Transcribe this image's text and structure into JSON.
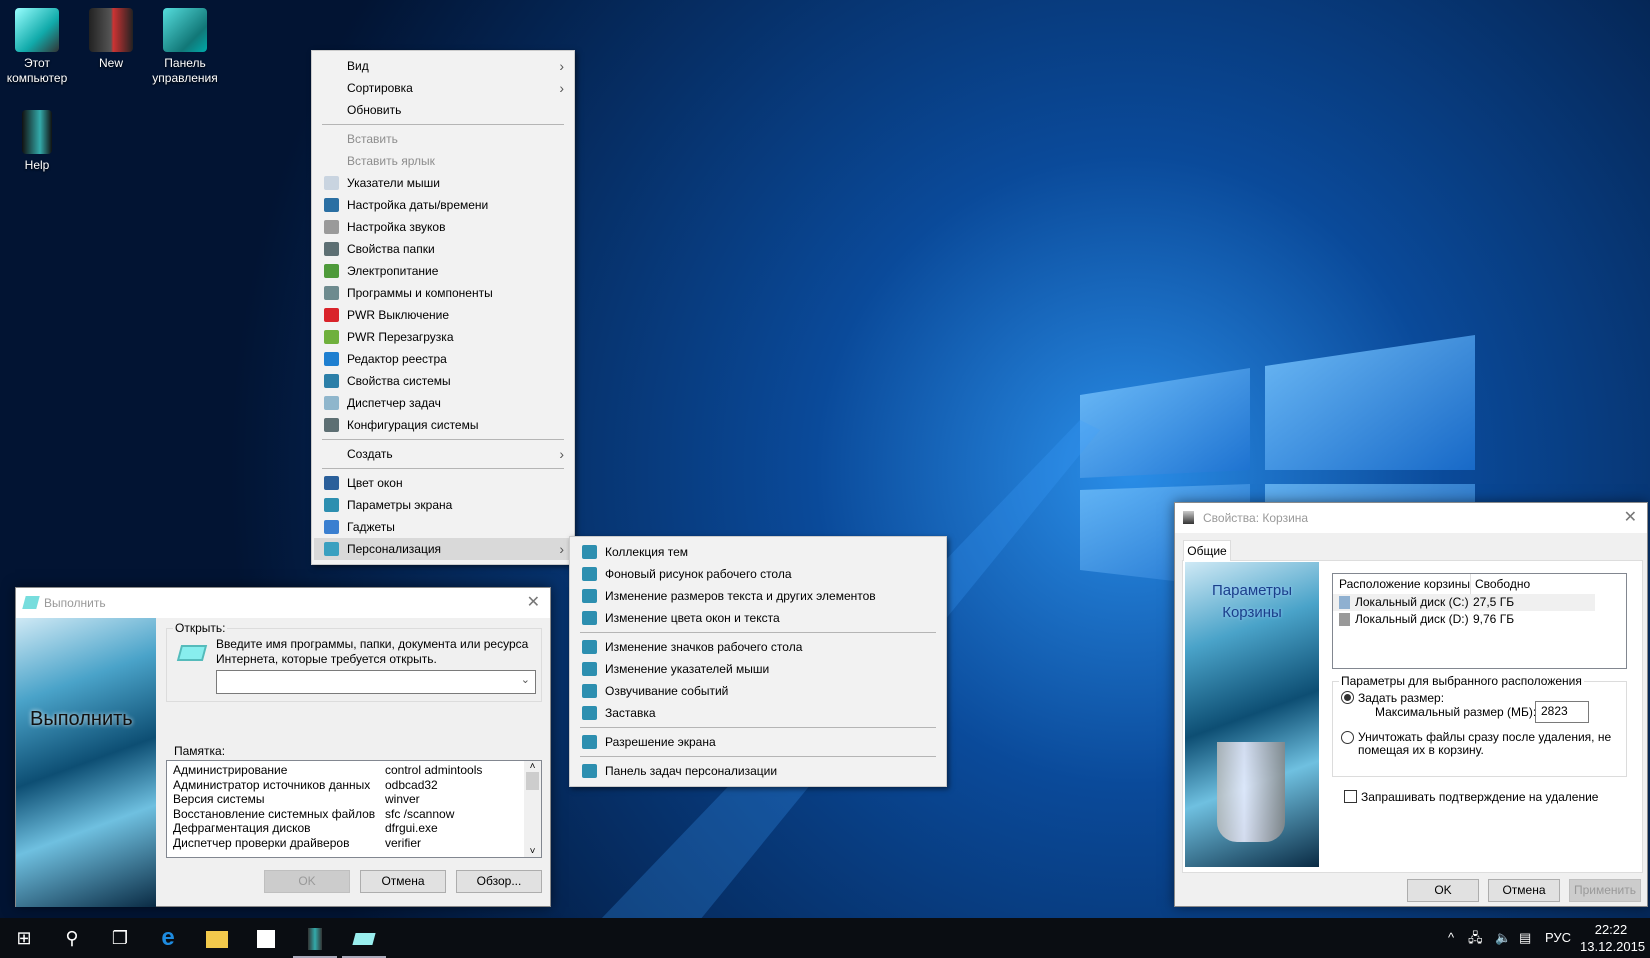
{
  "desktop": {
    "icons": [
      {
        "label": "Этот компьютер",
        "icon": "computer-icon"
      },
      {
        "label": "New",
        "icon": "user-folder-icon"
      },
      {
        "label": "Панель управления",
        "icon": "control-panel-icon"
      },
      {
        "label": "Help",
        "icon": "help-icon"
      }
    ]
  },
  "context_menu": {
    "group1": [
      {
        "label": "Вид",
        "submenu": true
      },
      {
        "label": "Сортировка",
        "submenu": true
      },
      {
        "label": "Обновить"
      }
    ],
    "group2": [
      {
        "label": "Вставить",
        "disabled": true
      },
      {
        "label": "Вставить ярлык",
        "disabled": true
      },
      {
        "label": "Указатели мыши",
        "icon": "cursor-icon",
        "color": "#c9d4e0"
      },
      {
        "label": "Настройка даты/времени",
        "icon": "datetime-icon",
        "color": "#2a6fa3"
      },
      {
        "label": "Настройка звуков",
        "icon": "speaker-icon",
        "color": "#9a9a9a"
      },
      {
        "label": "Свойства папки",
        "icon": "folder-options-icon",
        "color": "#5d6f73"
      },
      {
        "label": "Электропитание",
        "icon": "power-plug-icon",
        "color": "#4e9a3a"
      },
      {
        "label": "Программы и компоненты",
        "icon": "programs-icon",
        "color": "#6e8b8f"
      },
      {
        "label": "PWR Выключение",
        "icon": "shutdown-icon",
        "color": "#d9232a"
      },
      {
        "label": "PWR Перезагрузка",
        "icon": "restart-icon",
        "color": "#6fb03c"
      },
      {
        "label": "Редактор реестра",
        "icon": "registry-icon",
        "color": "#1e7fd0"
      },
      {
        "label": "Свойства системы",
        "icon": "system-properties-icon",
        "color": "#2c7fa8"
      },
      {
        "label": "Диспетчер задач",
        "icon": "task-manager-icon",
        "color": "#8fb6cc"
      },
      {
        "label": "Конфигурация системы",
        "icon": "msconfig-icon",
        "color": "#5d6f73"
      }
    ],
    "group3": [
      {
        "label": "Создать",
        "submenu": true
      }
    ],
    "group4": [
      {
        "label": "Цвет окон",
        "icon": "window-color-icon",
        "color": "#2a5f9a"
      },
      {
        "label": "Параметры экрана",
        "icon": "display-settings-icon",
        "color": "#2d8fb0"
      },
      {
        "label": "Гаджеты",
        "icon": "gadgets-icon",
        "color": "#3a7fd0"
      },
      {
        "label": "Персонализация",
        "icon": "personalization-icon",
        "color": "#3aa0c0",
        "submenu": true,
        "highlighted": true
      }
    ]
  },
  "submenu": {
    "group1": [
      {
        "label": "Коллекция тем"
      },
      {
        "label": "Фоновый рисунок рабочего стола"
      },
      {
        "label": "Изменение размеров текста и других элементов"
      },
      {
        "label": "Изменение цвета окон и текста"
      }
    ],
    "group2": [
      {
        "label": "Изменение значков рабочего стола"
      },
      {
        "label": "Изменение указателей мыши"
      },
      {
        "label": "Озвучивание событий"
      },
      {
        "label": "Заставка"
      }
    ],
    "group3": [
      {
        "label": "Разрешение экрана"
      }
    ],
    "group4": [
      {
        "label": "Панель задач персонализации"
      }
    ]
  },
  "run_dialog": {
    "title": "Выполнить",
    "banner": "Выполнить",
    "open_label": "Открыть:",
    "description": "Введите имя программы, папки, документа или ресурса Интернета, которые требуется открыть.",
    "input_value": "",
    "memo_label": "Памятка:",
    "memo": [
      [
        "Администрирование",
        "control admintools"
      ],
      [
        "Администратор источников данных",
        "odbcad32"
      ],
      [
        "Версия системы",
        "winver"
      ],
      [
        "Восстановление системных файлов",
        "sfc /scannow"
      ],
      [
        "Дефрагментация дисков",
        "dfrgui.exe"
      ],
      [
        "Диспетчер проверки драйверов",
        "verifier"
      ]
    ],
    "ok": "OK",
    "cancel": "Отмена",
    "browse": "Обзор..."
  },
  "recycle_dialog": {
    "title": "Свойства: Корзина",
    "tab": "Общие",
    "banner": "Параметры Корзины",
    "columns": [
      "Расположение корзины",
      "Свободно"
    ],
    "rows": [
      [
        "Локальный диск (C:)",
        "27,5 ГБ"
      ],
      [
        "Локальный диск (D:)",
        "9,76 ГБ"
      ]
    ],
    "group_label": "Параметры для выбранного расположения",
    "custom_size": "Задать размер:",
    "max_size_label": "Максимальный размер (МБ):",
    "max_size_value": "2823",
    "delete_immediately": "Уничтожать файлы сразу после удаления, не помещая их в корзину.",
    "confirm_delete": "Запрашивать подтверждение на удаление",
    "confirm_checked": false,
    "custom_selected": true,
    "ok": "OK",
    "cancel": "Отмена",
    "apply": "Применить"
  },
  "taskbar": {
    "apps": [
      "start-icon",
      "search-icon",
      "task-view-icon",
      "edge-icon",
      "file-explorer-icon",
      "store-icon",
      "recycle-bin-icon",
      "run-icon"
    ],
    "language": "РУС",
    "time": "22:22",
    "date": "13.12.2015"
  }
}
